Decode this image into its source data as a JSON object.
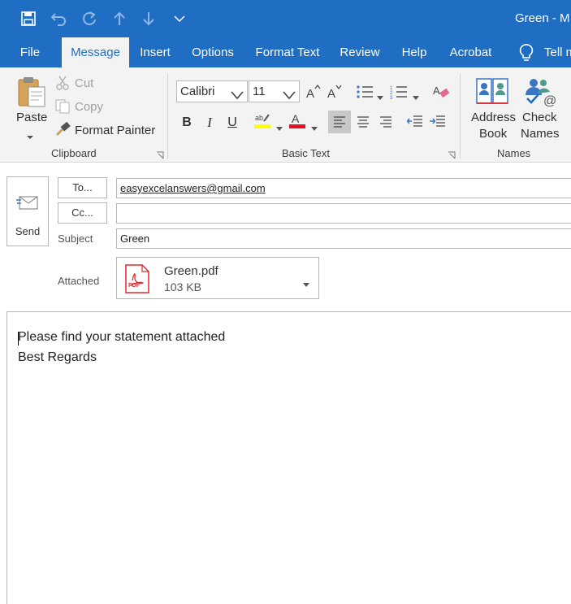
{
  "window": {
    "title": "Green - M"
  },
  "tabs": [
    {
      "label": "File"
    },
    {
      "label": "Message"
    },
    {
      "label": "Insert"
    },
    {
      "label": "Options"
    },
    {
      "label": "Format Text"
    },
    {
      "label": "Review"
    },
    {
      "label": "Help"
    },
    {
      "label": "Acrobat"
    },
    {
      "label": "Tell m"
    }
  ],
  "ribbon": {
    "clipboard": {
      "paste": "Paste",
      "cut": "Cut",
      "copy": "Copy",
      "format_painter": "Format Painter",
      "group_label": "Clipboard"
    },
    "basic_text": {
      "font": "Calibri",
      "size": "11",
      "group_label": "Basic Text"
    },
    "names": {
      "address_line1": "Address",
      "address_line2": "Book",
      "check_line1": "Check",
      "check_line2": "Names",
      "group_label": "Names"
    }
  },
  "compose": {
    "send_label": "Send",
    "to_label": "To...",
    "cc_label": "Cc...",
    "subject_label": "Subject",
    "attached_label": "Attached",
    "to_value": "easyexcelanswers@gmail.com",
    "cc_value": "",
    "subject_value": "Green",
    "attachment": {
      "name": "Green.pdf",
      "size": "103 KB",
      "badge": "PDF"
    }
  },
  "body": {
    "lines": [
      "Please find your statement attached",
      "Best Regards"
    ]
  },
  "colors": {
    "accent": "#1f6ec4",
    "ribbon_bg": "#f3f3f3",
    "highlight_yellow": "#ffff00",
    "font_red": "#e81123",
    "pdf_red": "#e0292d"
  }
}
